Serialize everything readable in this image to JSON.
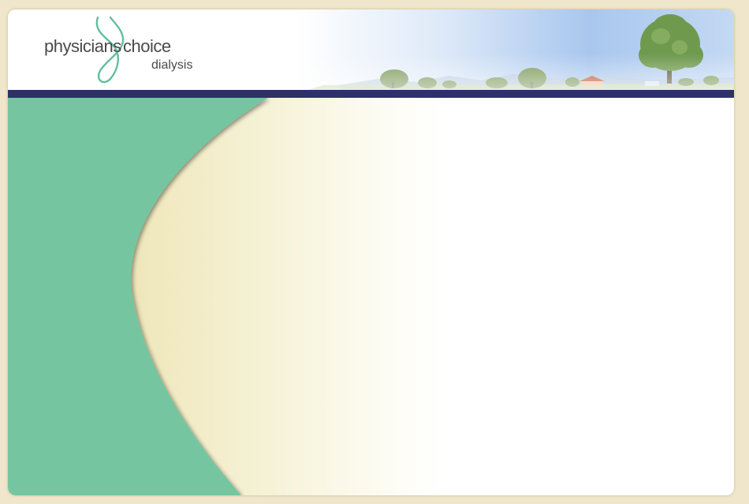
{
  "brand": {
    "word_physicians": "physicians",
    "word_choice": "choice",
    "word_dialysis": "dialysis"
  },
  "colors": {
    "background": "#efe6cc",
    "header_bar": "#2d3069",
    "green_panel": "#74c6a0",
    "logo_swirl": "#62bf9a",
    "logo_text": "#4a4a4a"
  },
  "icons": {
    "logo": "ribbon-swirl-logo",
    "header_scene": "countryside-trees-panorama"
  }
}
